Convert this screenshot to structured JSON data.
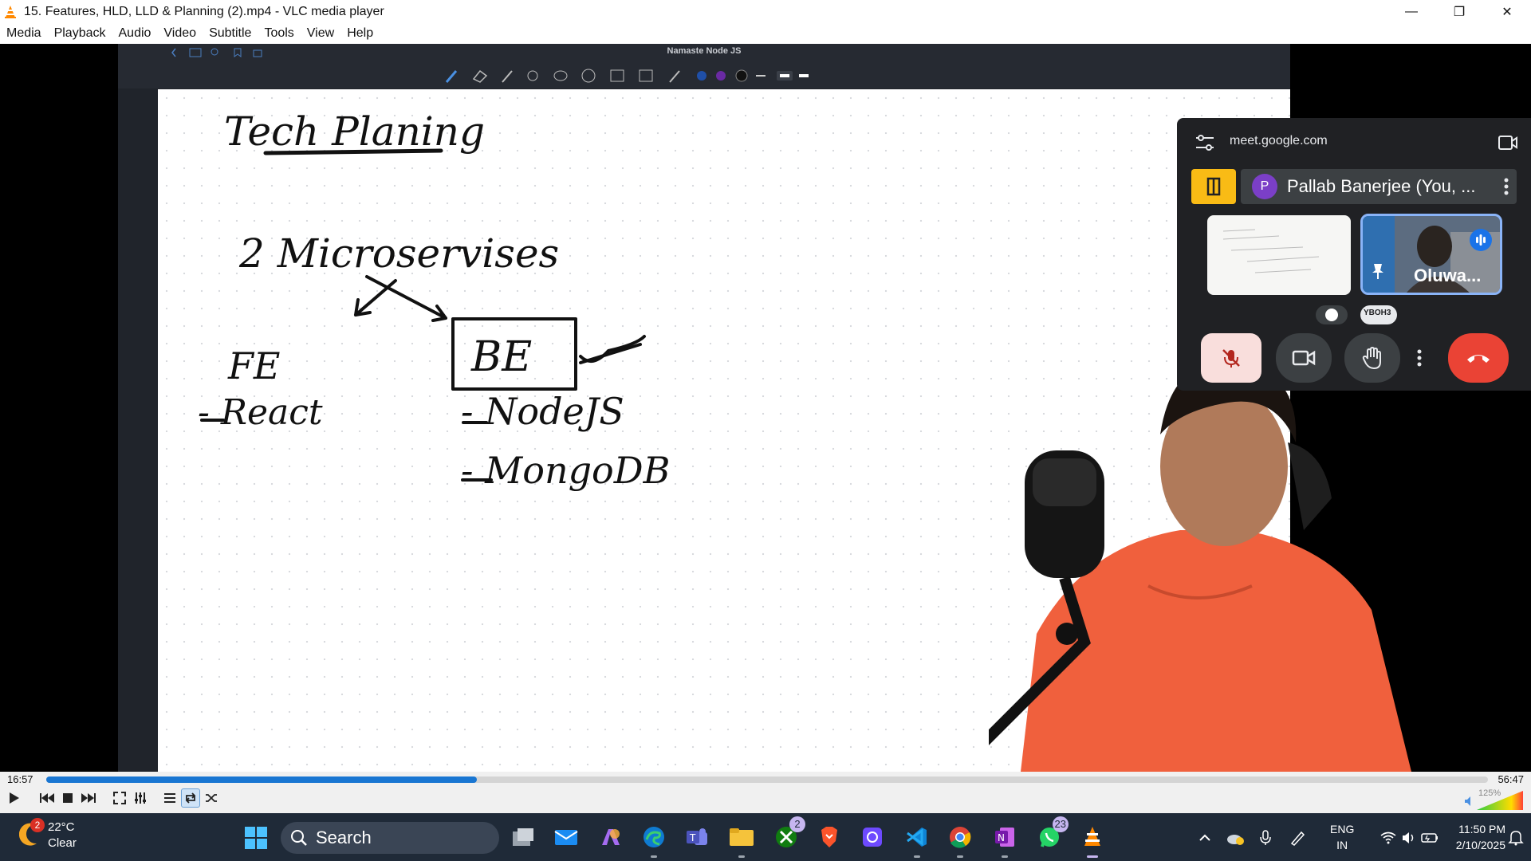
{
  "window": {
    "title": "15. Features, HLD, LLD & Planning (2).mp4 - VLC media player",
    "controls": [
      "minimize",
      "restore",
      "close"
    ]
  },
  "menu": [
    "Media",
    "Playback",
    "Audio",
    "Video",
    "Subtitle",
    "Tools",
    "View",
    "Help"
  ],
  "video": {
    "notes_app_title": "Namaste Node JS",
    "whiteboard_lines": [
      "Tech Planing",
      "2 Microservises",
      "FE",
      "BE",
      "- React",
      "- NodeJS",
      "- MongoDB"
    ],
    "meet": {
      "domain": "meet.google.com",
      "avatar_letter": "P",
      "participant_name": "Pallab Banerjee (You, ...",
      "tile_name": "Oluwa...",
      "speaker_chip": "YBOH3"
    }
  },
  "player": {
    "time_elapsed": "16:57",
    "time_total": "56:47",
    "progress": 0.2986,
    "volume_label": "125%",
    "volume_level": 1.25
  },
  "taskbar": {
    "weather_temp": "22°C",
    "weather_desc": "Clear",
    "weather_badge": "2",
    "search_label": "Search",
    "xbox_badge": "2",
    "whatsapp_badge": "23",
    "lang_line1": "ENG",
    "lang_line2": "IN",
    "time": "11:50 PM",
    "date": "2/10/2025"
  },
  "colors": {
    "vlc_orange": "#ff8800",
    "seek_fill": "#1976d2",
    "meet_bg": "#202124",
    "meet_end": "#ea4335",
    "taskbar_bg": "#1f2a38",
    "shirt": "#f0603d"
  }
}
